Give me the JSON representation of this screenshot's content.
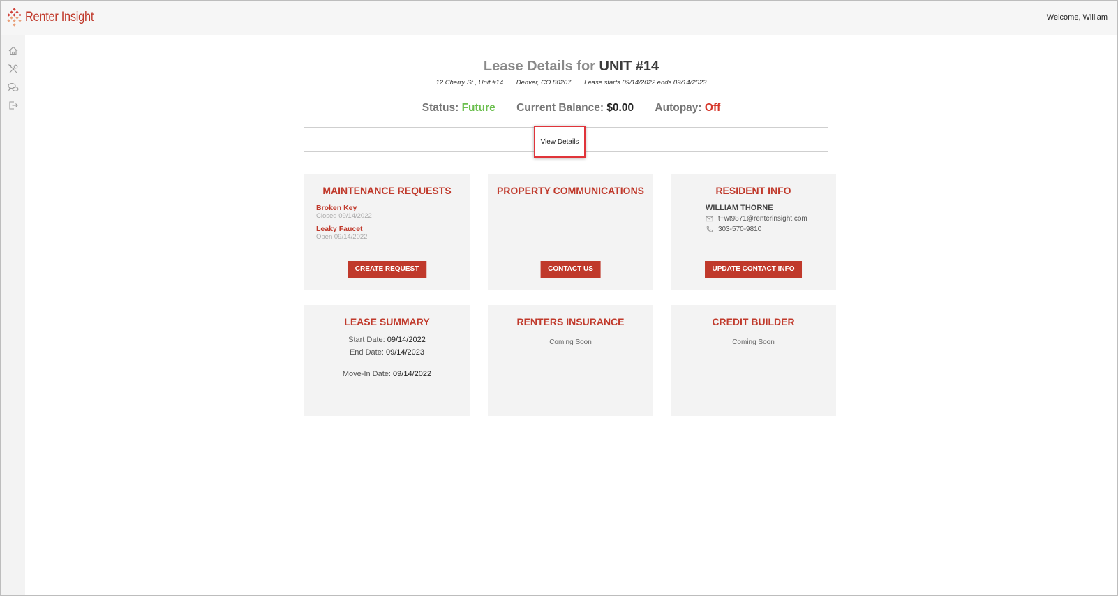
{
  "header": {
    "brand": "Renter Insight",
    "welcome": "Welcome, William"
  },
  "sidebar": {
    "items": [
      {
        "name": "home-icon"
      },
      {
        "name": "tools-icon"
      },
      {
        "name": "chat-icon"
      },
      {
        "name": "logout-icon"
      }
    ]
  },
  "lease": {
    "title_prefix": "Lease Details for",
    "unit": "UNIT #14",
    "address": "12 Cherry St., Unit #14",
    "city": "Denver, CO 80207",
    "term": "Lease starts 09/14/2022 ends 09/14/2023",
    "status_label": "Status:",
    "status_value": "Future",
    "balance_label": "Current Balance:",
    "balance_value": "$0.00",
    "autopay_label": "Autopay:",
    "autopay_value": "Off",
    "view_details": "View Details"
  },
  "cards": {
    "maintenance": {
      "title": "MAINTENANCE REQUESTS",
      "requests": [
        {
          "name": "Broken Key",
          "status": "Closed 09/14/2022"
        },
        {
          "name": "Leaky Faucet",
          "status": "Open 09/14/2022"
        }
      ],
      "button": "CREATE REQUEST"
    },
    "communications": {
      "title": "PROPERTY COMMUNICATIONS",
      "button": "CONTACT US"
    },
    "resident": {
      "title": "RESIDENT INFO",
      "name": "WILLIAM THORNE",
      "email": "t+wt9871@renterinsight.com",
      "phone": "303-570-9810",
      "button": "UPDATE CONTACT INFO"
    },
    "lease_summary": {
      "title": "LEASE SUMMARY",
      "start_label": "Start Date:",
      "start_value": "09/14/2022",
      "end_label": "End Date:",
      "end_value": "09/14/2023",
      "movein_label": "Move-In Date:",
      "movein_value": "09/14/2022"
    },
    "insurance": {
      "title": "RENTERS INSURANCE",
      "text": "Coming Soon"
    },
    "credit": {
      "title": "CREDIT BUILDER",
      "text": "Coming Soon"
    }
  },
  "colors": {
    "accent": "#c0392b",
    "status_future": "#6bbf4e",
    "status_off": "#d6372a",
    "highlight": "#e0343a"
  }
}
